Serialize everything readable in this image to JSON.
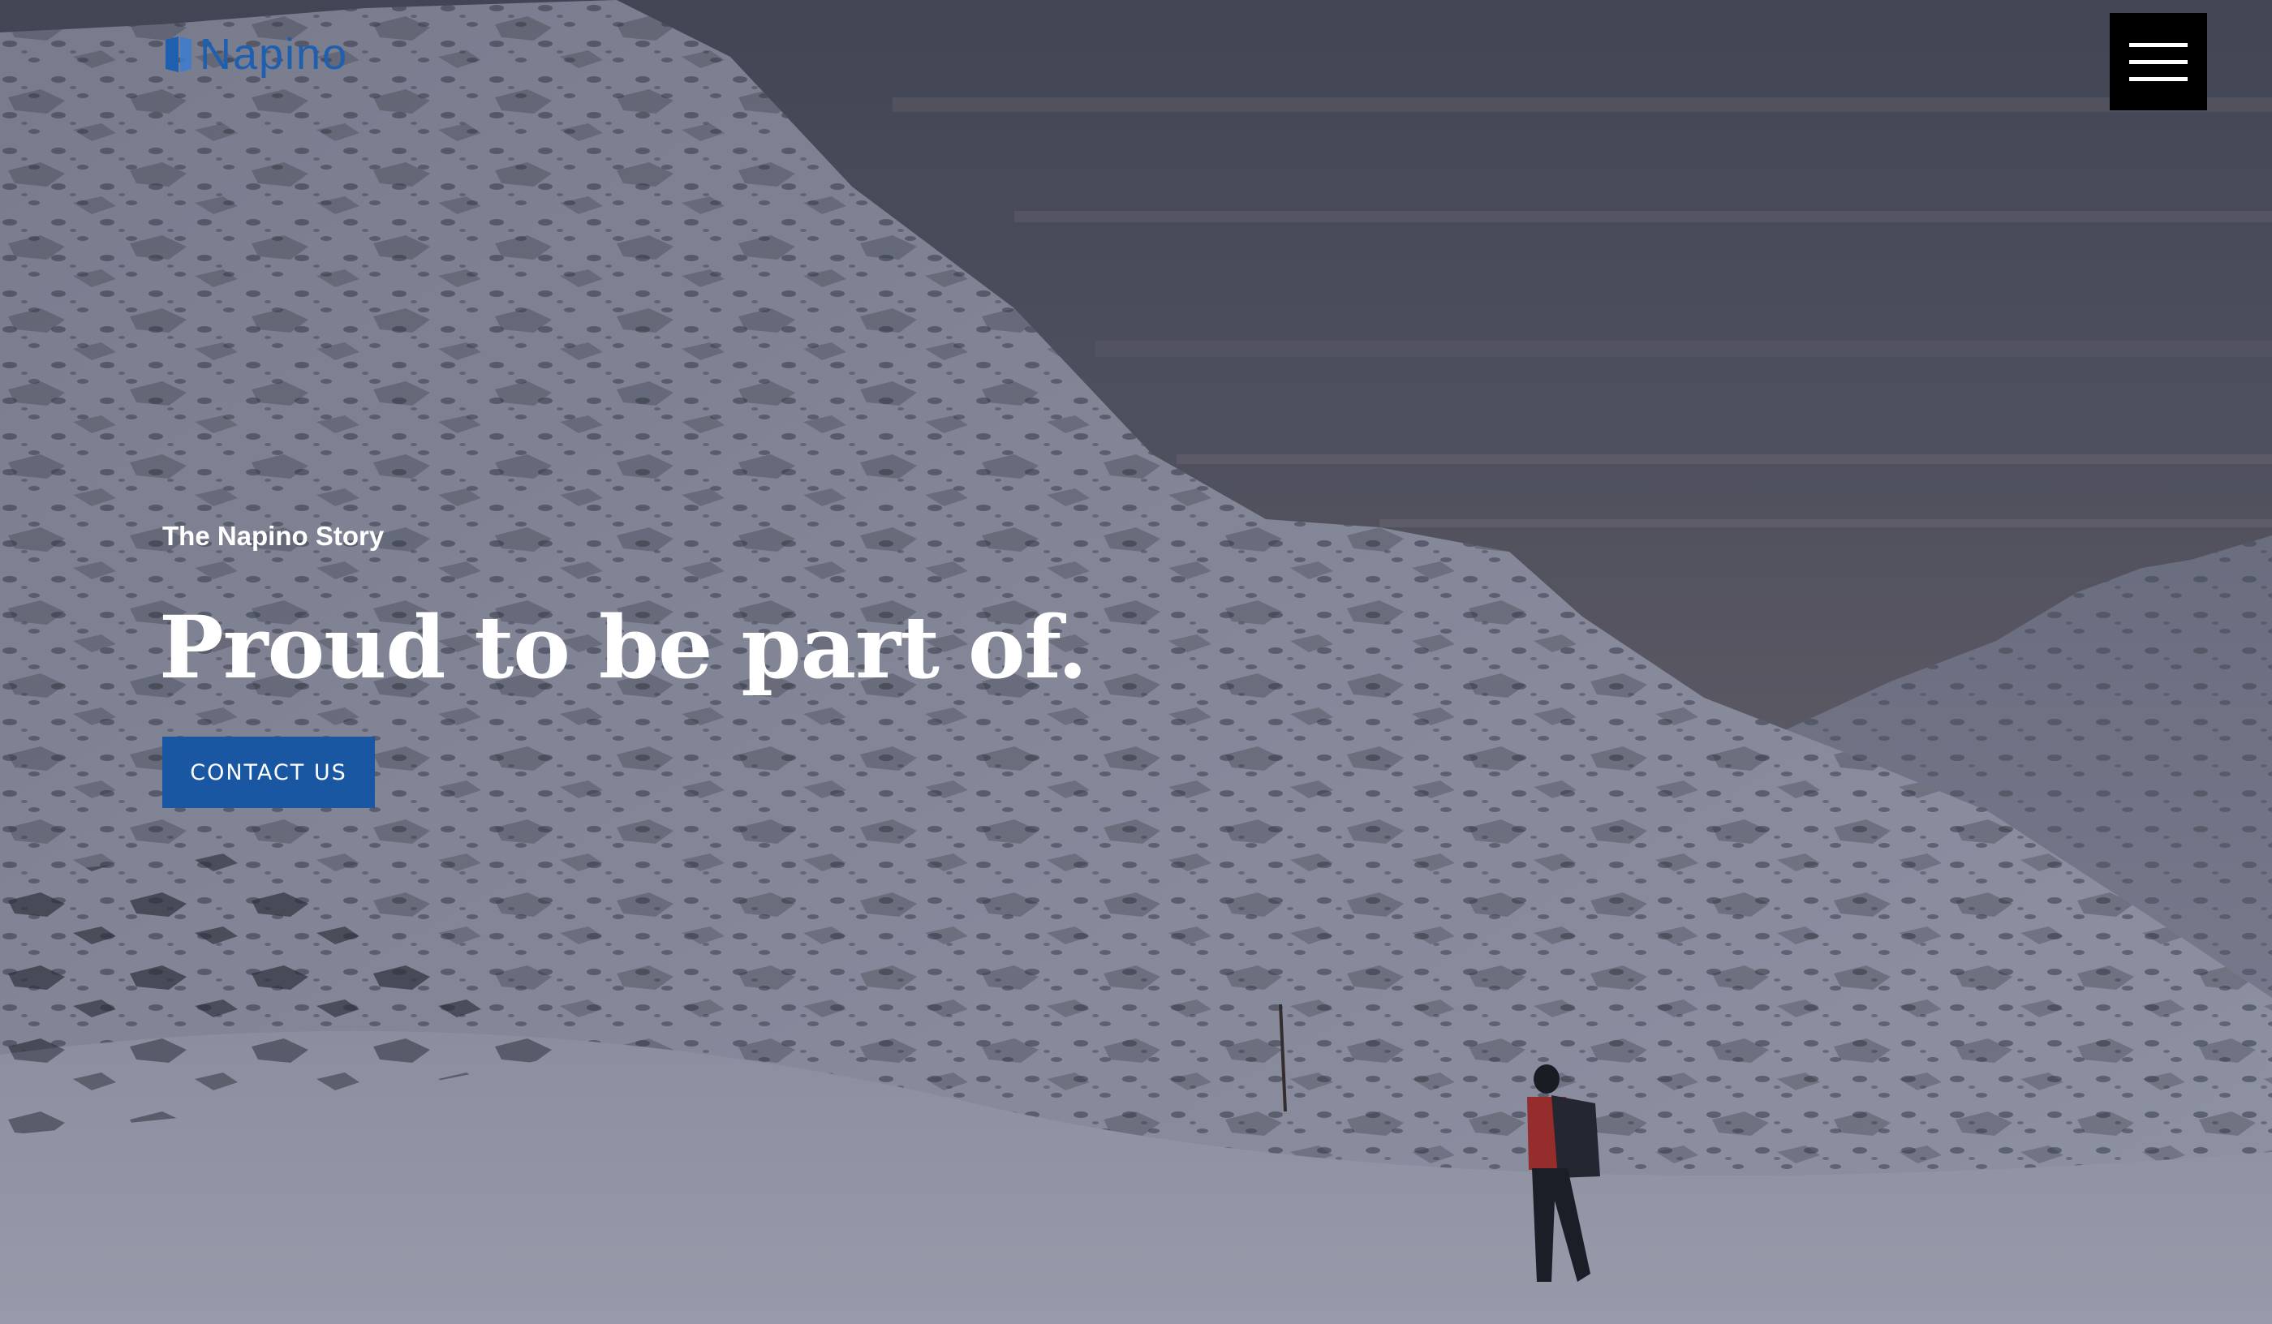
{
  "brand": {
    "logo_text": "Napino",
    "logo_color": "#1f5fb0",
    "logo_icon": "napino-mark-icon"
  },
  "header": {
    "menu_icon": "hamburger-menu-icon"
  },
  "hero": {
    "eyebrow": "The Napino Story",
    "headline": "Proud to be part of.",
    "cta_label": "CONTACT US",
    "cta_color": "#1a57a3",
    "background": "snowy-mountain-hiker-image"
  }
}
